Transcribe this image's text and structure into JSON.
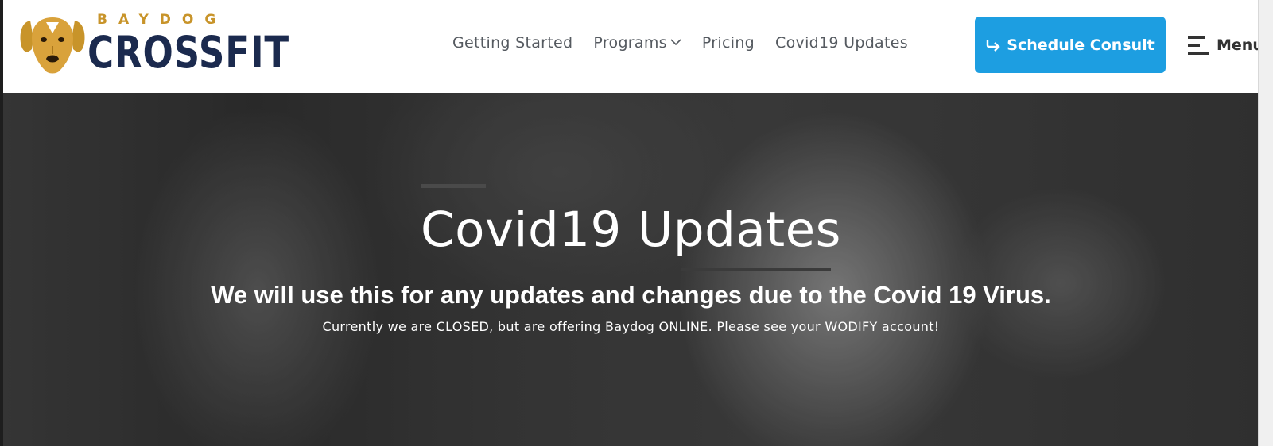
{
  "header": {
    "logo": {
      "top_text": "BAYDOG",
      "main_text": "CROSSFIT",
      "icon": "dog-head-logo-icon"
    },
    "nav": [
      {
        "label": "Getting Started"
      },
      {
        "label": "Programs",
        "icon": "chevron-down-icon"
      },
      {
        "label": "Pricing"
      },
      {
        "label": "Covid19 Updates"
      }
    ],
    "cta": {
      "label": "Schedule Consult",
      "icon": "arrow-turn-icon"
    },
    "menu": {
      "label": "Menu",
      "icon": "hamburger-icon"
    }
  },
  "hero": {
    "title": "Covid19 Updates",
    "subtitle": "We will use this for any updates and changes due to the Covid 19 Virus.",
    "text": "Currently we are CLOSED, but are offering Baydog ONLINE. Please see your WODIFY account!"
  },
  "colors": {
    "cta_background": "#1d9ee1",
    "logo_gold": "#c8942a",
    "logo_navy": "#1b2a4e",
    "nav_text": "#555a60"
  }
}
